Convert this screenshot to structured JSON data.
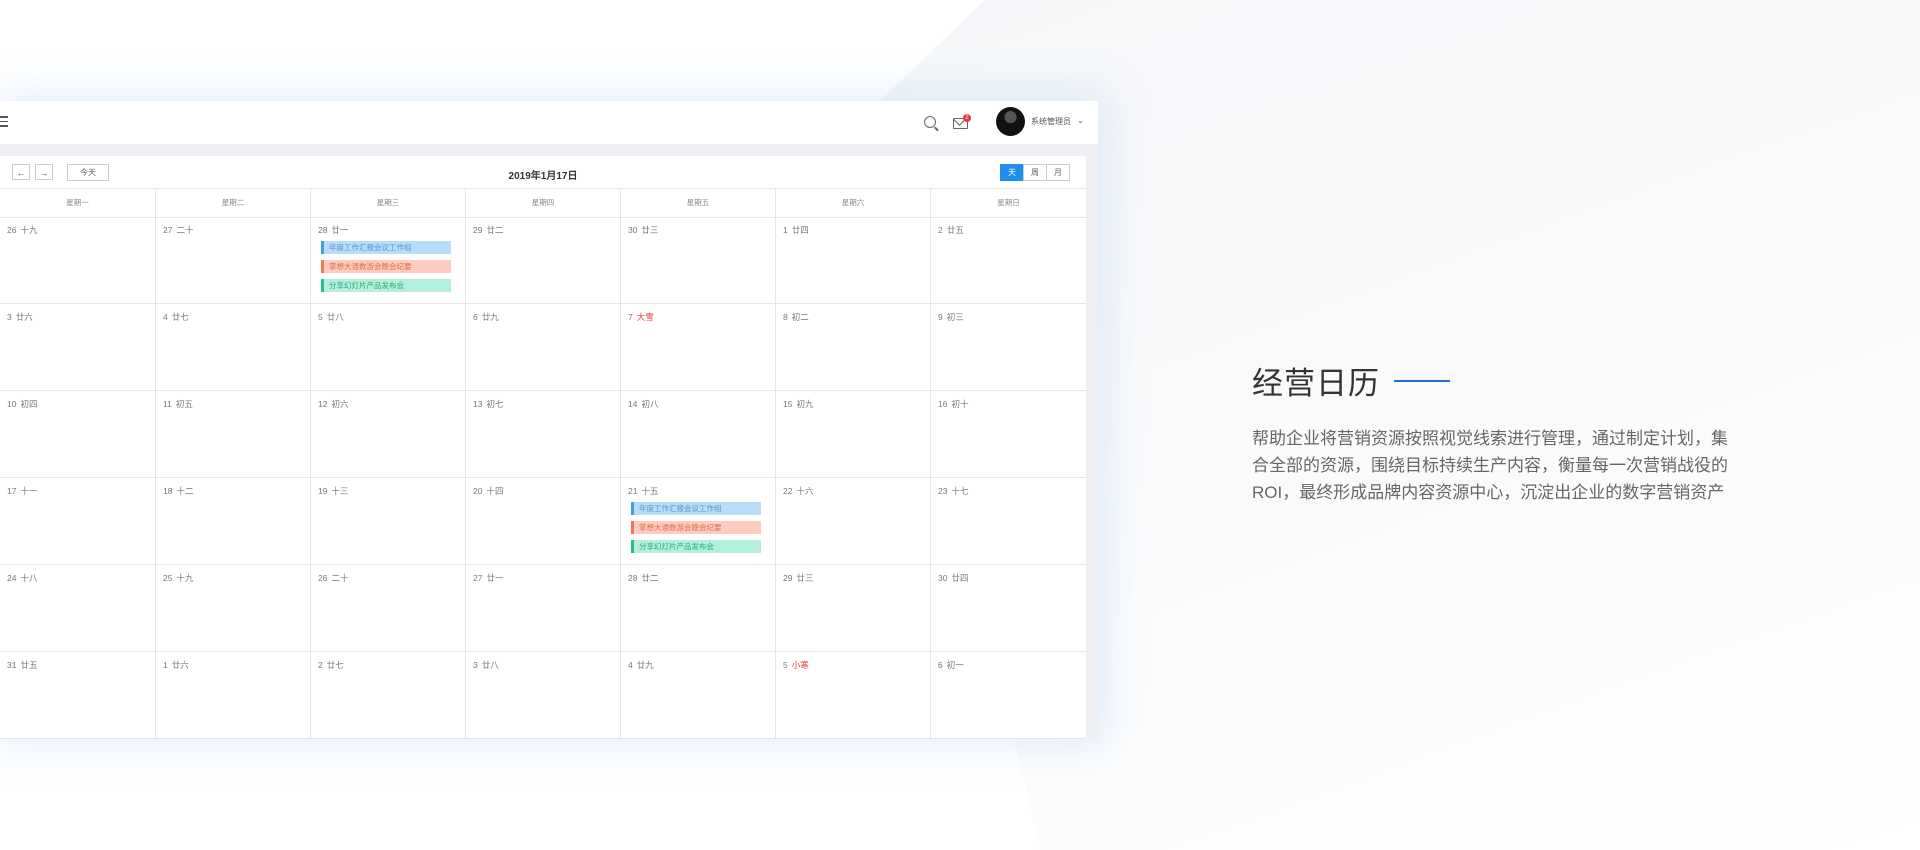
{
  "header": {
    "username": "系统管理员",
    "mail_badge": "2"
  },
  "toolbar": {
    "prev_label": "←",
    "next_label": "→",
    "today_label": "今天",
    "title": "2019年1月17日",
    "views": [
      {
        "label": "天",
        "active": true
      },
      {
        "label": "周",
        "active": false
      },
      {
        "label": "月",
        "active": false
      }
    ]
  },
  "weekdays": [
    "星期一",
    "星期二",
    "星期三",
    "星期四",
    "星期五",
    "星期六",
    "星期日"
  ],
  "weeks": [
    [
      {
        "day": "26",
        "lunar": "十九"
      },
      {
        "day": "27",
        "lunar": "二十"
      },
      {
        "day": "28",
        "lunar": "廿一",
        "events": [
          {
            "title": "年度工作汇报会议工作组",
            "color": "blue"
          },
          {
            "title": "掌想大通数游会晚会纪要",
            "color": "red"
          },
          {
            "title": "分享幻灯片产品发布会",
            "color": "green"
          }
        ]
      },
      {
        "day": "29",
        "lunar": "廿二"
      },
      {
        "day": "30",
        "lunar": "廿三"
      },
      {
        "day": "1",
        "lunar": "廿四"
      },
      {
        "day": "2",
        "lunar": "廿五"
      }
    ],
    [
      {
        "day": "3",
        "lunar": "廿六"
      },
      {
        "day": "4",
        "lunar": "廿七"
      },
      {
        "day": "5",
        "lunar": "廿八"
      },
      {
        "day": "6",
        "lunar": "廿九"
      },
      {
        "day": "7",
        "lunar": "大雪",
        "holiday": true
      },
      {
        "day": "8",
        "lunar": "初二"
      },
      {
        "day": "9",
        "lunar": "初三"
      }
    ],
    [
      {
        "day": "10",
        "lunar": "初四"
      },
      {
        "day": "11",
        "lunar": "初五"
      },
      {
        "day": "12",
        "lunar": "初六"
      },
      {
        "day": "13",
        "lunar": "初七"
      },
      {
        "day": "14",
        "lunar": "初八"
      },
      {
        "day": "15",
        "lunar": "初九"
      },
      {
        "day": "16",
        "lunar": "初十"
      }
    ],
    [
      {
        "day": "17",
        "lunar": "十一"
      },
      {
        "day": "18",
        "lunar": "十二"
      },
      {
        "day": "19",
        "lunar": "十三"
      },
      {
        "day": "20",
        "lunar": "十四"
      },
      {
        "day": "21",
        "lunar": "十五",
        "events": [
          {
            "title": "年度工作汇报会议工作组",
            "color": "blue"
          },
          {
            "title": "掌想大通数游会晚会纪要",
            "color": "red"
          },
          {
            "title": "分享幻灯片产品发布会",
            "color": "green"
          }
        ]
      },
      {
        "day": "22",
        "lunar": "十六"
      },
      {
        "day": "23",
        "lunar": "十七"
      }
    ],
    [
      {
        "day": "24",
        "lunar": "十八"
      },
      {
        "day": "25",
        "lunar": "十九"
      },
      {
        "day": "26",
        "lunar": "二十"
      },
      {
        "day": "27",
        "lunar": "廿一"
      },
      {
        "day": "28",
        "lunar": "廿二"
      },
      {
        "day": "29",
        "lunar": "廿三"
      },
      {
        "day": "30",
        "lunar": "廿四"
      }
    ],
    [
      {
        "day": "31",
        "lunar": "廿五"
      },
      {
        "day": "1",
        "lunar": "廿六"
      },
      {
        "day": "2",
        "lunar": "廿七"
      },
      {
        "day": "3",
        "lunar": "廿八"
      },
      {
        "day": "4",
        "lunar": "廿九"
      },
      {
        "day": "5",
        "lunar": "小寒",
        "holiday": true
      },
      {
        "day": "6",
        "lunar": "初一"
      }
    ]
  ],
  "feature": {
    "title": "经营日历",
    "description": "帮助企业将营销资源按照视觉线索进行管理，通过制定计划，集合全部的资源，围绕目标持续生产内容，衡量每一次营销战役的ROI，最终形成品牌内容资源中心，沉淀出企业的数字营销资产"
  },
  "colors": {
    "accent": "#1e8ef0",
    "holiday": "#e8383d",
    "title_line": "#1f6fd3"
  }
}
